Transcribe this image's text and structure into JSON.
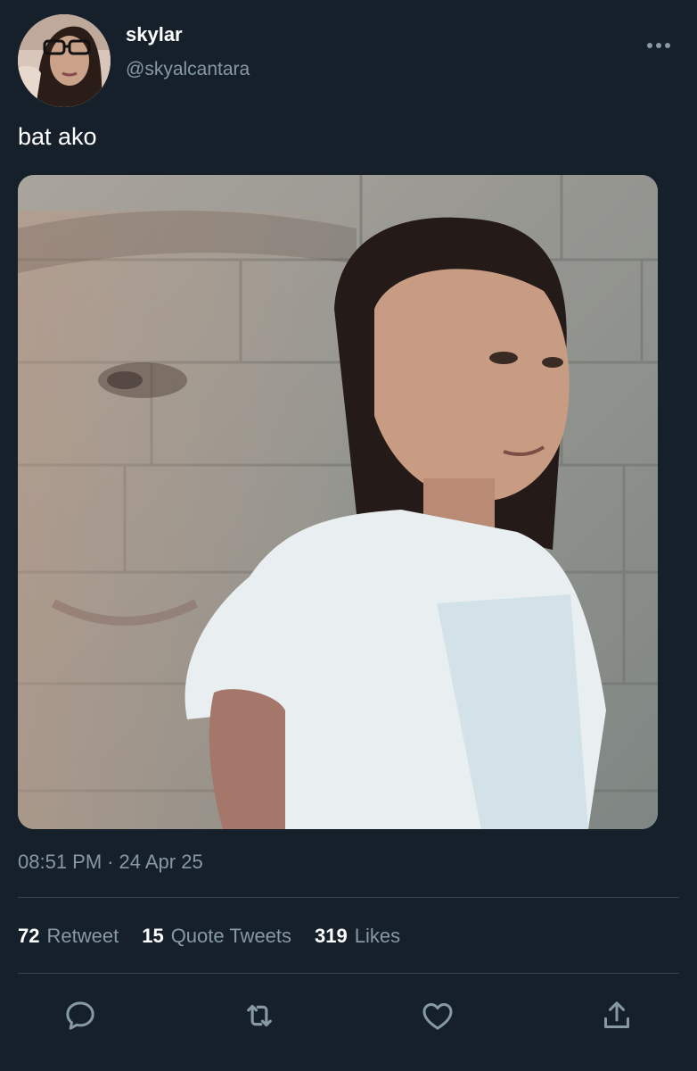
{
  "user": {
    "display_name": "skylar",
    "handle": "@skyalcantara"
  },
  "tweet": {
    "text": "bat ako",
    "time": "08:51 PM",
    "separator": "·",
    "date": "24 Apr 25"
  },
  "stats": {
    "retweets_count": "72",
    "retweets_label": "Retweet",
    "quotes_count": "15",
    "quotes_label": "Quote Tweets",
    "likes_count": "319",
    "likes_label": "Likes"
  },
  "icons": {
    "more": "more-horizontal-icon",
    "reply": "reply-icon",
    "retweet": "retweet-icon",
    "like": "heart-icon",
    "share": "share-icon"
  },
  "colors": {
    "background": "#15202b",
    "secondary_text": "#8899a6",
    "divider": "#38444d",
    "icon": "#8899a6"
  }
}
